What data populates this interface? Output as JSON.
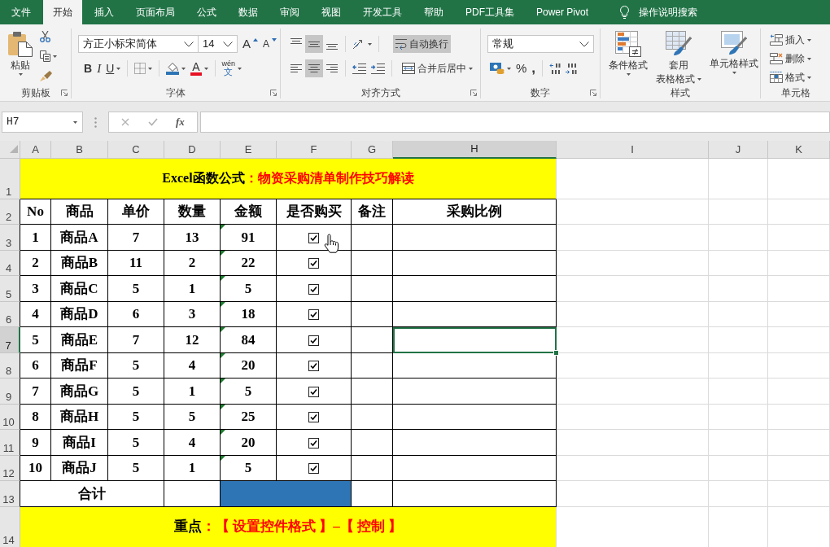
{
  "ribbon_tabs": [
    {
      "label": "文件",
      "selected": false
    },
    {
      "label": "开始",
      "selected": true
    },
    {
      "label": "插入",
      "selected": false
    },
    {
      "label": "页面布局",
      "selected": false
    },
    {
      "label": "公式",
      "selected": false
    },
    {
      "label": "数据",
      "selected": false
    },
    {
      "label": "审阅",
      "selected": false
    },
    {
      "label": "视图",
      "selected": false
    },
    {
      "label": "开发工具",
      "selected": false
    },
    {
      "label": "帮助",
      "selected": false
    },
    {
      "label": "PDF工具集",
      "selected": false
    },
    {
      "label": "Power Pivot",
      "selected": false
    }
  ],
  "tell_me": "操作说明搜索",
  "ribbon": {
    "clipboard": {
      "paste": "粘贴",
      "label": "剪贴板"
    },
    "font": {
      "font_name": "方正小标宋简体",
      "font_size": "14",
      "grow": "A",
      "shrink": "A",
      "bold": "B",
      "italic": "I",
      "underline": "U",
      "font_color": "A",
      "phonetic_top": "wén",
      "phonetic_bottom": "文",
      "label": "字体"
    },
    "alignment": {
      "vertical": [
        {
          "selected": false
        },
        {
          "selected": true
        },
        {
          "selected": false
        }
      ],
      "horizontal": [
        {
          "selected": false
        },
        {
          "selected": true
        },
        {
          "selected": false
        }
      ],
      "wrap_text": {
        "label": "自动换行",
        "selected": true
      },
      "merge": "合并后居中",
      "label": "对齐方式"
    },
    "number": {
      "format": "常规",
      "percent": "%",
      "comma": ",",
      "label": "数字"
    },
    "styles": {
      "buttons": [
        {
          "kind": "conditional",
          "lines": [
            "条件格式"
          ]
        },
        {
          "kind": "table",
          "lines": [
            "套用",
            "表格格式"
          ]
        },
        {
          "kind": "cell_styles",
          "lines": [
            "单元格样式"
          ]
        }
      ],
      "label": "样式"
    },
    "cells": {
      "buttons": [
        {
          "kind": "insert",
          "label": "插入"
        },
        {
          "kind": "delete",
          "label": "删除"
        },
        {
          "kind": "format",
          "label": "格式"
        }
      ],
      "label": "单元格"
    }
  },
  "formula_bar": {
    "name_box": "H7",
    "function_label": "fx"
  },
  "sheet": {
    "columns": [
      {
        "label": "A",
        "selected": false
      },
      {
        "label": "B",
        "selected": false
      },
      {
        "label": "C",
        "selected": false
      },
      {
        "label": "D",
        "selected": false
      },
      {
        "label": "E",
        "selected": false
      },
      {
        "label": "F",
        "selected": false
      },
      {
        "label": "G",
        "selected": false
      },
      {
        "label": "H",
        "selected": true
      },
      {
        "label": "I",
        "selected": false
      },
      {
        "label": "J",
        "selected": false
      },
      {
        "label": "K",
        "selected": false
      }
    ],
    "row_numbers": [
      {
        "label": "1",
        "selected": false
      },
      {
        "label": "2",
        "selected": false
      },
      {
        "label": "3",
        "selected": false
      },
      {
        "label": "4",
        "selected": false
      },
      {
        "label": "5",
        "selected": false
      },
      {
        "label": "6",
        "selected": false
      },
      {
        "label": "7",
        "selected": true
      },
      {
        "label": "8",
        "selected": false
      },
      {
        "label": "9",
        "selected": false
      },
      {
        "label": "10",
        "selected": false
      },
      {
        "label": "11",
        "selected": false
      },
      {
        "label": "12",
        "selected": false
      },
      {
        "label": "13",
        "selected": false
      },
      {
        "label": "14",
        "selected": false
      }
    ],
    "title": {
      "lead": "Excel函数公式",
      "rest": "：物资采购清单制作技巧解读"
    },
    "header": [
      "No",
      "商品",
      "单价",
      "数量",
      "金额",
      "是否购买",
      "备注",
      "采购比例"
    ],
    "rows": [
      {
        "no": "1",
        "item": "商品A",
        "price": "7",
        "qty": "13",
        "amount": "91",
        "flagged": true,
        "checked": true,
        "hovered": true
      },
      {
        "no": "2",
        "item": "商品B",
        "price": "11",
        "qty": "2",
        "amount": "22",
        "flagged": true,
        "checked": true,
        "hovered": false
      },
      {
        "no": "3",
        "item": "商品C",
        "price": "5",
        "qty": "1",
        "amount": "5",
        "flagged": true,
        "checked": true,
        "hovered": false
      },
      {
        "no": "4",
        "item": "商品D",
        "price": "6",
        "qty": "3",
        "amount": "18",
        "flagged": true,
        "checked": true,
        "hovered": false
      },
      {
        "no": "5",
        "item": "商品E",
        "price": "7",
        "qty": "12",
        "amount": "84",
        "flagged": true,
        "checked": true,
        "hovered": false
      },
      {
        "no": "6",
        "item": "商品F",
        "price": "5",
        "qty": "4",
        "amount": "20",
        "flagged": true,
        "checked": true,
        "hovered": false
      },
      {
        "no": "7",
        "item": "商品G",
        "price": "5",
        "qty": "1",
        "amount": "5",
        "flagged": true,
        "checked": true,
        "hovered": false
      },
      {
        "no": "8",
        "item": "商品H",
        "price": "5",
        "qty": "5",
        "amount": "25",
        "flagged": true,
        "checked": true,
        "hovered": false
      },
      {
        "no": "9",
        "item": "商品I",
        "price": "5",
        "qty": "4",
        "amount": "20",
        "flagged": true,
        "checked": true,
        "hovered": false
      },
      {
        "no": "10",
        "item": "商品J",
        "price": "5",
        "qty": "1",
        "amount": "5",
        "flagged": true,
        "checked": true,
        "hovered": false
      }
    ],
    "total": {
      "label": "合计",
      "amount_filled": true
    },
    "note": {
      "lead": "重点",
      "rest": "：【 设置控件格式 】–【 控制 】"
    }
  }
}
